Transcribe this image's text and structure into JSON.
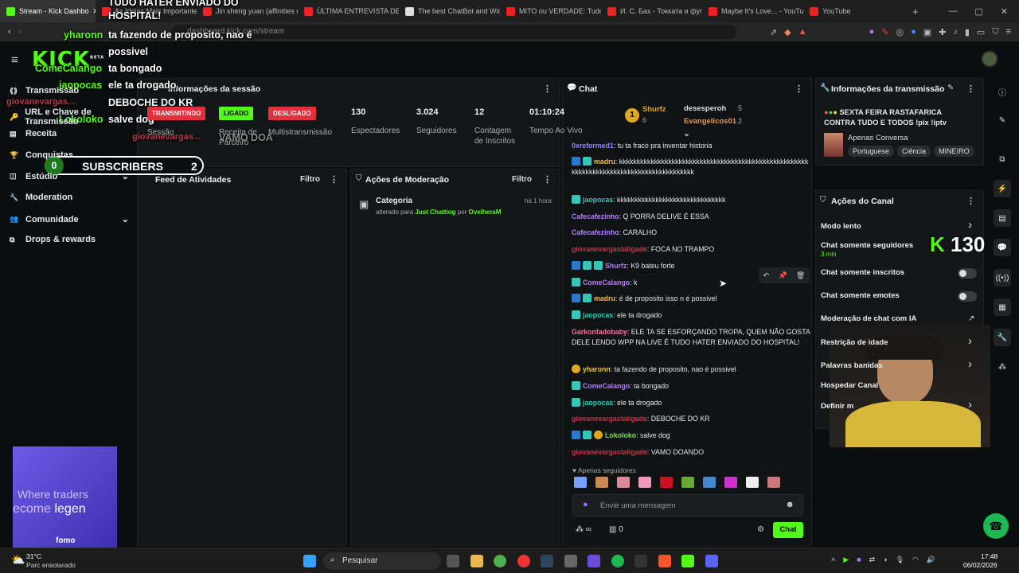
{
  "browser": {
    "tabs": [
      {
        "title": "Stream - Kick Dashbo",
        "color": "#53fc18"
      },
      {
        "title": "As Ideias Mais Importante",
        "color": "#e22"
      },
      {
        "title": "Jin sheng yuan (affinities o",
        "color": "#e22"
      },
      {
        "title": "ÚLTIMA ENTREVISTA DE JE",
        "color": "#e22"
      },
      {
        "title": "The best ChatBot and Wid",
        "color": "#ddd"
      },
      {
        "title": "MITO ou VERDADE: Tudo",
        "color": "#e22"
      },
      {
        "title": "И. С. Бах - Токката и фуга",
        "color": "#e22"
      },
      {
        "title": "Maybe It's Love... - YouTu",
        "color": "#e22"
      },
      {
        "title": "YouTube",
        "color": "#e22"
      }
    ],
    "url": "dashboard.kick.com/stream",
    "new_tab": "+"
  },
  "brand": {
    "logo": "KICK",
    "beta": "BETA"
  },
  "sidebar": {
    "items": [
      {
        "label": "Transmissão",
        "icon": "broadcast-icon"
      },
      {
        "label": "URL e Chave de Transmissão",
        "icon": "key-icon"
      },
      {
        "label": "Receita",
        "icon": "receipt-icon"
      },
      {
        "label": "Conquistas",
        "icon": "trophy-icon"
      },
      {
        "label": "Estúdio",
        "icon": "studio-icon"
      },
      {
        "label": "Moderation",
        "icon": "wrench-icon"
      },
      {
        "label": "Comunidade",
        "icon": "people-icon"
      },
      {
        "label": "Drops & rewards",
        "icon": "gift-icon"
      }
    ],
    "ad": {
      "line1": "Where traders",
      "line2a": "ecome ",
      "line2b": "legen",
      "brand": "fomo"
    }
  },
  "session": {
    "title": "Informações da sessão",
    "badges": [
      {
        "text": "TRANSMITINDO",
        "label": "Sessão",
        "bg": "#e4303a"
      },
      {
        "text": "LIGADO",
        "label": "Receita de Parceiro",
        "bg": "#53fc18"
      },
      {
        "text": "DESLIGADO",
        "label": "Multistransmissão",
        "bg": "#e4303a"
      }
    ],
    "stats": [
      {
        "value": "130",
        "label": "Espectadores"
      },
      {
        "value": "3.024",
        "label": "Seguidores"
      },
      {
        "value": "12",
        "label": "Contagem de Inscritos"
      },
      {
        "value": "01:10:24",
        "label": "Tempo Ao Vivo"
      }
    ]
  },
  "feed": {
    "title": "Feed de Atividades",
    "filter": "Filtro"
  },
  "modactions": {
    "title": "Ações de Moderação",
    "filter": "Filtro",
    "item": {
      "title": "Categoria",
      "prefix": "alterado para ",
      "category": "Just Chatting",
      "by": " por ",
      "user": "OvelheraM",
      "time": "há 1 hora"
    }
  },
  "chat": {
    "title": "Chat",
    "leaders": [
      {
        "name": "Shurfz",
        "count": "6"
      },
      {
        "name": "desesperoh",
        "count": "5"
      },
      {
        "name": "Evangelicos01",
        "count": "2"
      }
    ],
    "rank": "1",
    "messages": [
      {
        "user": "0xreformed1",
        "color": "#8b8bff",
        "text": "tu ta fraco pra inventar historia",
        "badges": []
      },
      {
        "user": "madru",
        "color": "#f0c040",
        "text": "kkkkkkkkkkkkkkkkkkkkkkkkkkkkkkkkkkkkkkkkkkkkkkkkkkkkkkkkkkkkkkkkkkkkkkkkkkkkkkkkkkkkkkkkk",
        "badges": [
          "b1",
          "b2"
        ]
      },
      {
        "user": "jaopocas",
        "color": "#35c6b9",
        "text": "kkkkkkkkkkkkkkkkkkkkkkkkkkkkkkk",
        "badges": [
          "b2"
        ]
      },
      {
        "user": "Cafecafezinho",
        "color": "#b57cff",
        "text": "Q PORRA DELIVE É ESSA",
        "badges": []
      },
      {
        "user": "Cafecafezinho",
        "color": "#b57cff",
        "text": "CARALHO",
        "badges": []
      },
      {
        "user": "giovanevargastaligade",
        "color": "#c0394b",
        "text": "FOCA NO TRAMPO",
        "badges": []
      },
      {
        "user": "Shurfz",
        "color": "#b57cff",
        "text": "K9 bateu forte",
        "badges": [
          "b1",
          "b2",
          "b2"
        ]
      },
      {
        "user": "ComeCalango",
        "color": "#b57cff",
        "text": "k",
        "badges": [
          "b2"
        ]
      },
      {
        "user": "madru",
        "color": "#f0c040",
        "text": "é de proposito isso n é possivel",
        "badges": [
          "b1",
          "b2"
        ]
      },
      {
        "user": "jaopocas",
        "color": "#35c6b9",
        "text": "ele ta drogado",
        "badges": [
          "b2"
        ]
      },
      {
        "user": "Garkonfadobaby",
        "color": "#ff6b9a",
        "text": "ELE TA SE ESFORÇANDO TROPA, QUEM NÃO GOSTA DELE LENDO WPP NA LIVE É TUDO HATER ENVIADO DO HOSPITAL!",
        "badges": []
      },
      {
        "user": "yharonn",
        "color": "#f0c040",
        "text": "ta fazendo de proposito, nao é possivel",
        "badges": [
          "b3"
        ]
      },
      {
        "user": "ComeCalango",
        "color": "#b57cff",
        "text": "ta bongado",
        "badges": [
          "b2"
        ]
      },
      {
        "user": "jaopocas",
        "color": "#35c6b9",
        "text": "ele ta drogado",
        "badges": [
          "b2"
        ]
      },
      {
        "user": "giovanevargastaligade",
        "color": "#c0394b",
        "text": "DEBOCHE DO KR",
        "badges": []
      },
      {
        "user": "Lokoloko",
        "color": "#7ed957",
        "text": "salve dog",
        "badges": [
          "b1",
          "b2",
          "b3"
        ]
      },
      {
        "user": "giovanevargastaligade",
        "color": "#c0394b",
        "text": "VAMO DOANDO",
        "badges": []
      }
    ],
    "followers_only": "Apenas seguidores",
    "input_placeholder": "Envie uma mensagem",
    "points": "∞",
    "store_count": "0",
    "send": "Chat"
  },
  "overlay": {
    "lines": [
      {
        "user": "",
        "text": "TUDO HATER ENVIADO DO"
      },
      {
        "user": "",
        "text": "HOSPITAL!"
      },
      {
        "user": "yharonn",
        "text": "ta fazendo de proposito, nao é"
      },
      {
        "user": "",
        "text": "possivel"
      },
      {
        "user": "ComeCalango",
        "text": "ta bongado"
      },
      {
        "user": "jaopocas",
        "text": "ele ta drogado"
      },
      {
        "user": "giovanevargas...",
        "text": "DEBOCHE DO KR"
      },
      {
        "user": "Lokoloko",
        "text": "salve dog"
      },
      {
        "user": "giovanevargas...",
        "text": "VAMO DOA"
      }
    ],
    "sub_left": "0",
    "sub_label": "SUBSCRIBERS",
    "sub_right": "2",
    "viewers": "130"
  },
  "streaminfo": {
    "title": "Informações da transmissão",
    "stream_title": "SEXTA FEIRA RASTAFARICA",
    "stream_title2": "CONTRA TUDO E TODOS",
    "stream_title3": "!pix !iptv",
    "category": "Apenas Conversa",
    "tags": [
      "Portuguese",
      "Ciência",
      "MINEIRO"
    ]
  },
  "channel": {
    "title": "Ações do Canal",
    "items": [
      {
        "label": "Modo lento",
        "kind": "arrow"
      },
      {
        "label": "Chat somente seguidores",
        "kind": "none",
        "sub": "3 min"
      },
      {
        "label": "Chat somente inscritos",
        "kind": "toggle"
      },
      {
        "label": "Chat somente emotes",
        "kind": "toggle"
      },
      {
        "label": "Moderação de chat com IA",
        "kind": "link"
      },
      {
        "label": "Restrição de idade",
        "kind": "arrow"
      },
      {
        "label": "Palavras banidas",
        "kind": "arrow"
      },
      {
        "label": "Hospedar Canal",
        "kind": "none"
      },
      {
        "label": "Definir m",
        "kind": "arrow"
      }
    ]
  },
  "taskbar": {
    "weather_temp": "31°C",
    "weather_desc": "Parc ensolarado",
    "search": "Pesquisar",
    "time": "17:48",
    "date": "06/02/2026"
  }
}
